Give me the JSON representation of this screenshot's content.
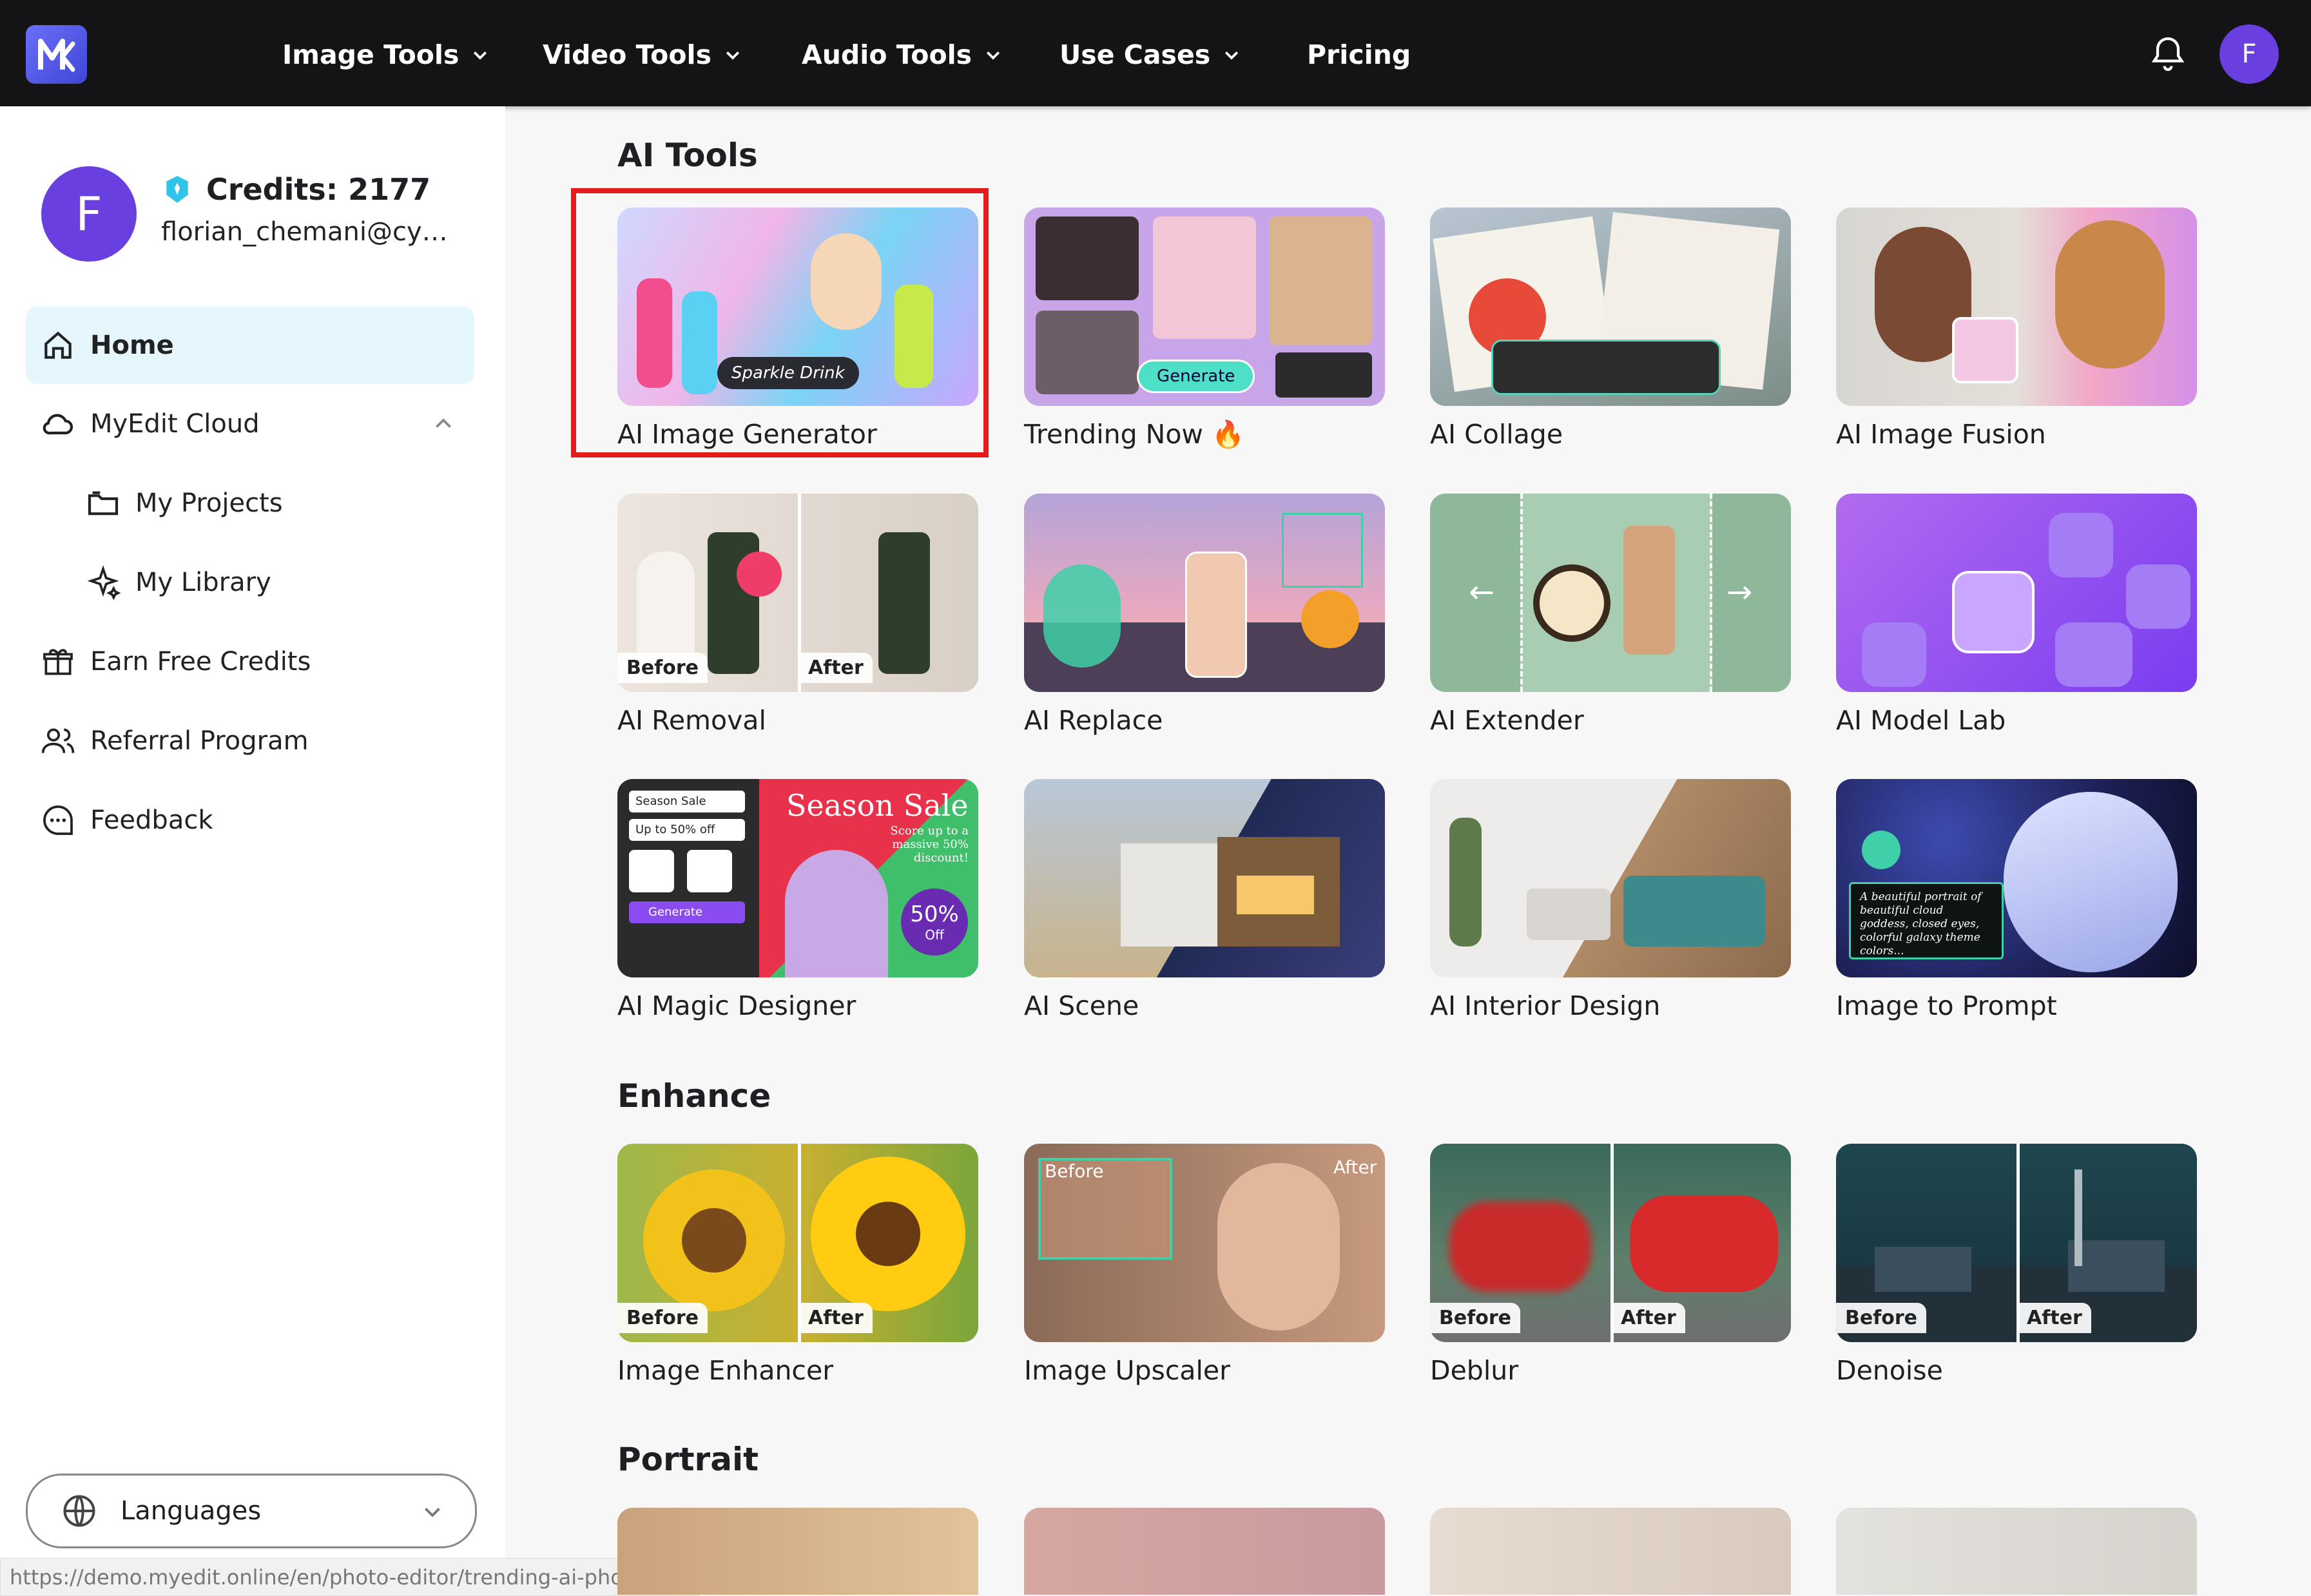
{
  "nav": {
    "items": [
      "Image Tools",
      "Video Tools",
      "Audio Tools",
      "Use Cases",
      "Pricing"
    ],
    "avatar_initial": "F"
  },
  "sidebar": {
    "avatar_initial": "F",
    "credits": "Credits: 2177",
    "email": "florian_chemani@cyb...",
    "items": [
      {
        "label": "Home",
        "icon": "home-icon"
      },
      {
        "label": "MyEdit Cloud",
        "icon": "cloud-icon"
      },
      {
        "label": "My Projects",
        "icon": "folder-icon"
      },
      {
        "label": "My Library",
        "icon": "sparkle-icon"
      },
      {
        "label": "Earn Free Credits",
        "icon": "gift-icon"
      },
      {
        "label": "Referral Program",
        "icon": "users-icon"
      },
      {
        "label": "Feedback",
        "icon": "chat-icon"
      }
    ],
    "languages": "Languages"
  },
  "status_url": "https://demo.myedit.online/en/photo-editor/trending-ai-photo/edit",
  "sections": {
    "ai_tools": {
      "title": "AI Tools",
      "cards": [
        "AI Image Generator",
        "Trending Now 🔥",
        "AI Collage",
        "AI Image Fusion",
        "AI Removal",
        "AI Replace",
        "AI Extender",
        "AI Model Lab",
        "AI Magic Designer",
        "AI Scene",
        "AI Interior Design",
        "Image to Prompt"
      ]
    },
    "enhance": {
      "title": "Enhance",
      "cards": [
        "Image Enhancer",
        "Image Upscaler",
        "Deblur",
        "Denoise"
      ]
    },
    "portrait": {
      "title": "Portrait"
    }
  },
  "thumb_text": {
    "sparkle_drink": "Sparkle Drink",
    "generate": "Generate",
    "before": "Before",
    "after": "After",
    "season_sale": "Season Sale",
    "season_sub": "Score up to a massive 50% discount!",
    "up_to": "Up to 50% off",
    "fifty_off": "50%",
    "off": "Off",
    "prompt_text": "A beautiful portrait of beautiful cloud goddess, closed eyes, colorful galaxy theme colors..."
  },
  "colors": {
    "topbar": "#141416",
    "accent": "#6a3fe0",
    "active_bg": "#e5f6fd",
    "highlight": "#e31b1b"
  }
}
